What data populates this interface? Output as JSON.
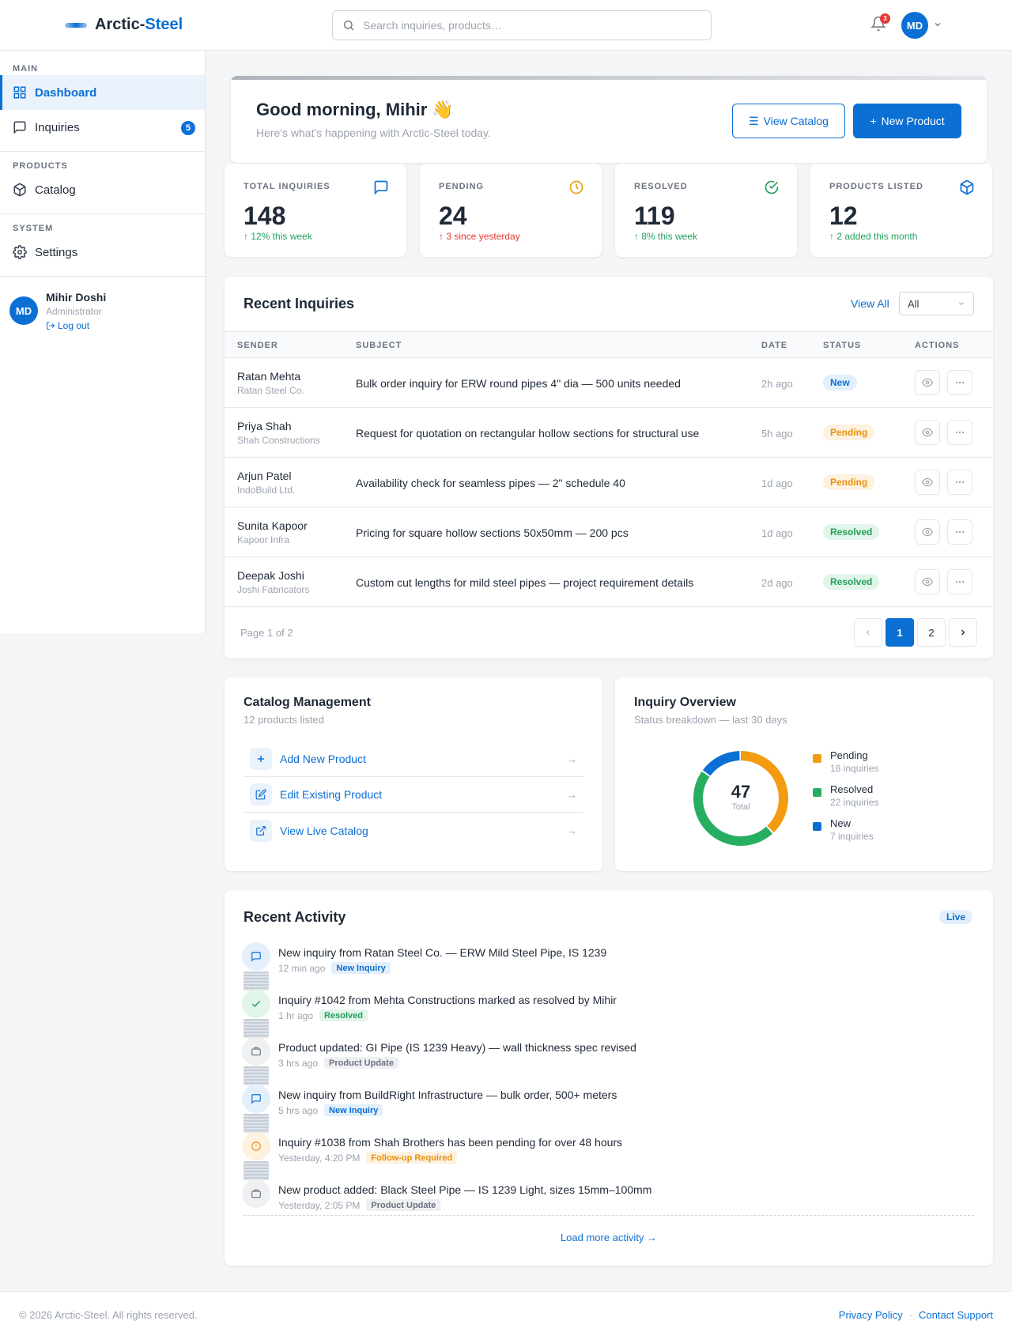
{
  "header": {
    "logo_prefix": "Arctic-",
    "logo_accent": "Steel",
    "search_placeholder": "Search inquiries, products…",
    "notification_count": "3",
    "user_initials": "MD"
  },
  "sidebar": {
    "sections": [
      {
        "label": "MAIN",
        "items": [
          {
            "label": "Dashboard",
            "icon": "grid-icon",
            "active": true
          },
          {
            "label": "Inquiries",
            "icon": "message-icon",
            "badge": "5"
          }
        ]
      },
      {
        "label": "PRODUCTS",
        "items": [
          {
            "label": "Catalog",
            "icon": "box-icon"
          }
        ]
      },
      {
        "label": "SYSTEM",
        "items": [
          {
            "label": "Settings",
            "icon": "gear-icon"
          }
        ]
      }
    ],
    "user": {
      "initials": "MD",
      "name": "Mihir Doshi",
      "role": "Administrator",
      "logout": "Log out"
    }
  },
  "welcome": {
    "greeting": "Good morning, Mihir 👋",
    "subtitle": "Here's what's happening with Arctic-Steel today.",
    "view_catalog": "View Catalog",
    "new_product": "New Product"
  },
  "stats": [
    {
      "label": "TOTAL INQUIRIES",
      "value": "148",
      "delta": "↑ 12% this week",
      "trend": "up",
      "icon": "message-icon",
      "color": "#0b6fd3"
    },
    {
      "label": "PENDING",
      "value": "24",
      "delta": "↑ 3 since yesterday",
      "trend": "down",
      "icon": "clock-icon",
      "color": "#e8a010"
    },
    {
      "label": "RESOLVED",
      "value": "119",
      "delta": "↑ 8% this week",
      "trend": "up",
      "icon": "check-circle-icon",
      "color": "#22a05b"
    },
    {
      "label": "PRODUCTS LISTED",
      "value": "12",
      "delta": "↑ 2 added this month",
      "trend": "up",
      "icon": "box-icon",
      "color": "#0b6fd3"
    }
  ],
  "inquiries": {
    "title": "Recent Inquiries",
    "view_all": "View All",
    "filter_value": "All",
    "columns": [
      "SENDER",
      "SUBJECT",
      "DATE",
      "STATUS",
      "ACTIONS"
    ],
    "rows": [
      {
        "name": "Ratan Mehta",
        "company": "Ratan Steel Co.",
        "subject": "Bulk order inquiry for ERW round pipes 4\" dia — 500 units needed",
        "date": "2h ago",
        "status": "New"
      },
      {
        "name": "Priya Shah",
        "company": "Shah Constructions",
        "subject": "Request for quotation on rectangular hollow sections for structural use",
        "date": "5h ago",
        "status": "Pending"
      },
      {
        "name": "Arjun Patel",
        "company": "IndoBuild Ltd.",
        "subject": "Availability check for seamless pipes — 2\" schedule 40",
        "date": "1d ago",
        "status": "Pending"
      },
      {
        "name": "Sunita Kapoor",
        "company": "Kapoor Infra",
        "subject": "Pricing for square hollow sections 50x50mm — 200 pcs",
        "date": "1d ago",
        "status": "Resolved"
      },
      {
        "name": "Deepak Joshi",
        "company": "Joshi Fabricators",
        "subject": "Custom cut lengths for mild steel pipes — project requirement details",
        "date": "2d ago",
        "status": "Resolved"
      }
    ],
    "page_info": "Page 1 of 2",
    "pages": [
      "1",
      "2"
    ],
    "current_page": "1"
  },
  "catalog": {
    "title": "Catalog Management",
    "subtitle": "12 products listed",
    "items": [
      {
        "label": "Add New Product",
        "icon": "plus-icon",
        "arrow": "→"
      },
      {
        "label": "Edit Existing Product",
        "icon": "edit-icon",
        "arrow": "→"
      },
      {
        "label": "View Live Catalog",
        "icon": "external-link-icon",
        "arrow": "→"
      }
    ]
  },
  "overview": {
    "title": "Inquiry Overview",
    "subtitle": "Status breakdown — last 30 days",
    "total": "47",
    "total_label": "Total",
    "legend": [
      {
        "name": "Pending",
        "detail": "18 inquiries",
        "value": 18,
        "color": "#f39c12"
      },
      {
        "name": "Resolved",
        "detail": "22 inquiries",
        "value": 22,
        "color": "#27ae60"
      },
      {
        "name": "New",
        "detail": "7 inquiries",
        "value": 7,
        "color": "#0b6fd3"
      }
    ]
  },
  "activity": {
    "title": "Recent Activity",
    "live": "Live",
    "items": [
      {
        "text": "New inquiry from Ratan Steel Co. — ERW Mild Steel Pipe, IS 1239",
        "time": "12 min ago",
        "tag": "New Inquiry",
        "kind": "blue",
        "icon": "message-icon"
      },
      {
        "text": "Inquiry #1042 from Mehta Constructions marked as resolved by Mihir",
        "time": "1 hr ago",
        "tag": "Resolved",
        "kind": "green",
        "icon": "check-icon"
      },
      {
        "text": "Product updated: GI Pipe (IS 1239 Heavy) — wall thickness spec revised",
        "time": "3 hrs ago",
        "tag": "Product Update",
        "kind": "gray",
        "icon": "package-icon"
      },
      {
        "text": "New inquiry from BuildRight Infrastructure — bulk order, 500+ meters",
        "time": "5 hrs ago",
        "tag": "New Inquiry",
        "kind": "blue",
        "icon": "message-icon"
      },
      {
        "text": "Inquiry #1038 from Shah Brothers has been pending for over 48 hours",
        "time": "Yesterday, 4:20 PM",
        "tag": "Follow-up Required",
        "kind": "orange",
        "icon": "alert-icon"
      },
      {
        "text": "New product added: Black Steel Pipe — IS 1239 Light, sizes 15mm–100mm",
        "time": "Yesterday, 2:05 PM",
        "tag": "Product Update",
        "kind": "gray",
        "icon": "package-icon"
      }
    ],
    "load_more": "Load more activity →"
  },
  "footer": {
    "copyright": "© 2026 Arctic-Steel. All rights reserved.",
    "privacy": "Privacy Policy",
    "separator": "·",
    "support": "Contact Support"
  }
}
